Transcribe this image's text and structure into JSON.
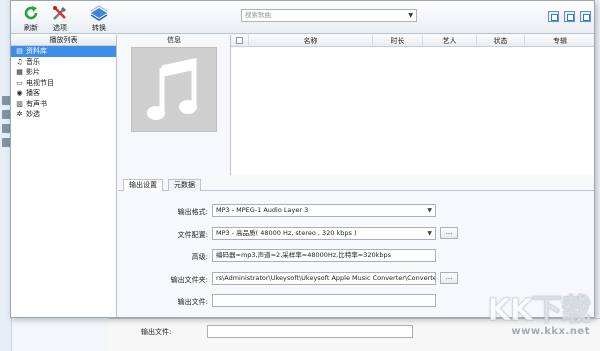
{
  "toolbar": {
    "refresh_label": "刷新",
    "options_label": "选项",
    "convert_label": "转换",
    "search_placeholder": "搜索歌曲"
  },
  "library": {
    "header": "播放列表",
    "items": [
      {
        "label": "资料库",
        "icon": "library-icon"
      },
      {
        "label": "音乐",
        "icon": "music-note-icon"
      },
      {
        "label": "影片",
        "icon": "film-icon"
      },
      {
        "label": "电视节目",
        "icon": "tv-icon"
      },
      {
        "label": "播客",
        "icon": "podcast-icon"
      },
      {
        "label": "有声书",
        "icon": "audiobook-icon"
      },
      {
        "label": "妙选",
        "icon": "genius-icon"
      }
    ],
    "selected": 0
  },
  "info": {
    "header": "信息",
    "artwork_icon": "music-note-placeholder-icon"
  },
  "table": {
    "columns": [
      "名称",
      "时长",
      "艺人",
      "状态",
      "专辑"
    ]
  },
  "tabs": [
    {
      "label": "输出设置",
      "active": true
    },
    {
      "label": "元数据",
      "active": false
    }
  ],
  "output": {
    "format_label": "输出格式:",
    "format_value": "MP3 - MPEG-1 Audio Layer 3",
    "profile_label": "文件配置:",
    "profile_value": "MP3 - 高品质( 48000 Hz, stereo , 320 kbps  )",
    "advanced_label": "高级:",
    "advanced_value": "编码器=mp3,声道=2,采样率=48000Hz,比特率=320kbps",
    "folder_label": "输出文件夹:",
    "folder_value": "rs\\Administrator\\Ukeysoft\\Ukeysoft Apple Music Converter\\Converted",
    "file_label": "输出文件:",
    "file_value": "",
    "browse_label": "...",
    "profile_btn_label": "..."
  },
  "background": {
    "output_file_label": "输出文件:"
  },
  "watermark": {
    "logo": "KK下载",
    "url": "www.kkx.net"
  }
}
